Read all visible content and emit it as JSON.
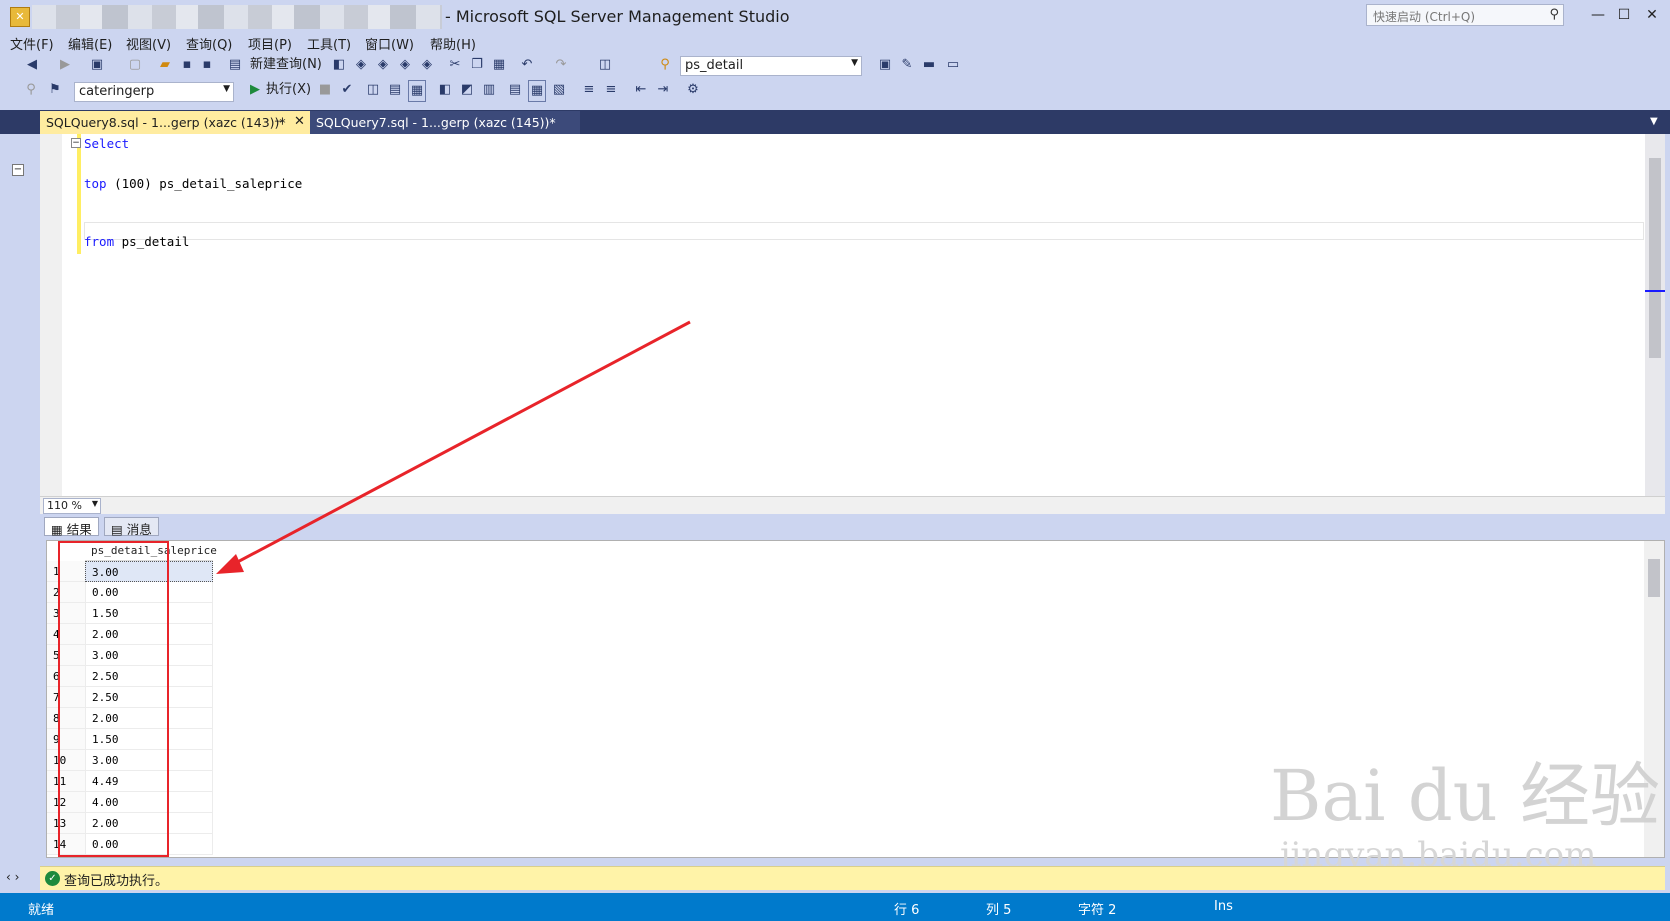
{
  "window": {
    "title": "- Microsoft SQL Server Management Studio",
    "quick_launch_placeholder": "快速启动 (Ctrl+Q)",
    "minimize": "—",
    "maximize": "☐",
    "close": "✕"
  },
  "menu": [
    "文件(F)",
    "编辑(E)",
    "视图(V)",
    "查询(Q)",
    "项目(P)",
    "工具(T)",
    "窗口(W)",
    "帮助(H)"
  ],
  "toolbar1": {
    "new_query_label": "新建查询(N)",
    "object_combo": "ps_detail"
  },
  "toolbar2": {
    "database_combo": "cateringerp",
    "execute_label": "执行(X)"
  },
  "tabs": [
    {
      "label": "SQLQuery8.sql - 1...gerp (xazc (143))*",
      "active": true
    },
    {
      "label": "SQLQuery7.sql - 1...gerp (xazc (145))*",
      "active": false
    }
  ],
  "editor": {
    "lines": [
      {
        "kw": "Select",
        "rest": ""
      },
      {
        "kw": "top",
        "rest": " (100) ps_detail_saleprice"
      },
      {
        "kw": "from",
        "rest": " ps_detail"
      }
    ],
    "zoom": "110 %"
  },
  "results": {
    "tabs": [
      "结果",
      "消息"
    ],
    "column": "ps_detail_saleprice",
    "rows": [
      {
        "n": "1",
        "v": "3.00"
      },
      {
        "n": "2",
        "v": "0.00"
      },
      {
        "n": "3",
        "v": "1.50"
      },
      {
        "n": "4",
        "v": "2.00"
      },
      {
        "n": "5",
        "v": "3.00"
      },
      {
        "n": "6",
        "v": "2.50"
      },
      {
        "n": "7",
        "v": "2.50"
      },
      {
        "n": "8",
        "v": "2.00"
      },
      {
        "n": "9",
        "v": "1.50"
      },
      {
        "n": "10",
        "v": "3.00"
      },
      {
        "n": "11",
        "v": "4.49"
      },
      {
        "n": "12",
        "v": "4.00"
      },
      {
        "n": "13",
        "v": "2.00"
      },
      {
        "n": "14",
        "v": "0.00"
      }
    ]
  },
  "status_message": "查询已成功执行。",
  "statusbar": {
    "ready": "就绪",
    "row": "行 6",
    "col": "列 5",
    "char": "字符 2",
    "mode": "Ins"
  },
  "watermark": {
    "brand": "Bai du 经验",
    "url": "jingyan.baidu.com"
  },
  "colors": {
    "accent": "#007acc",
    "tab_active": "#ffeca0",
    "annotation": "#e8242a"
  }
}
